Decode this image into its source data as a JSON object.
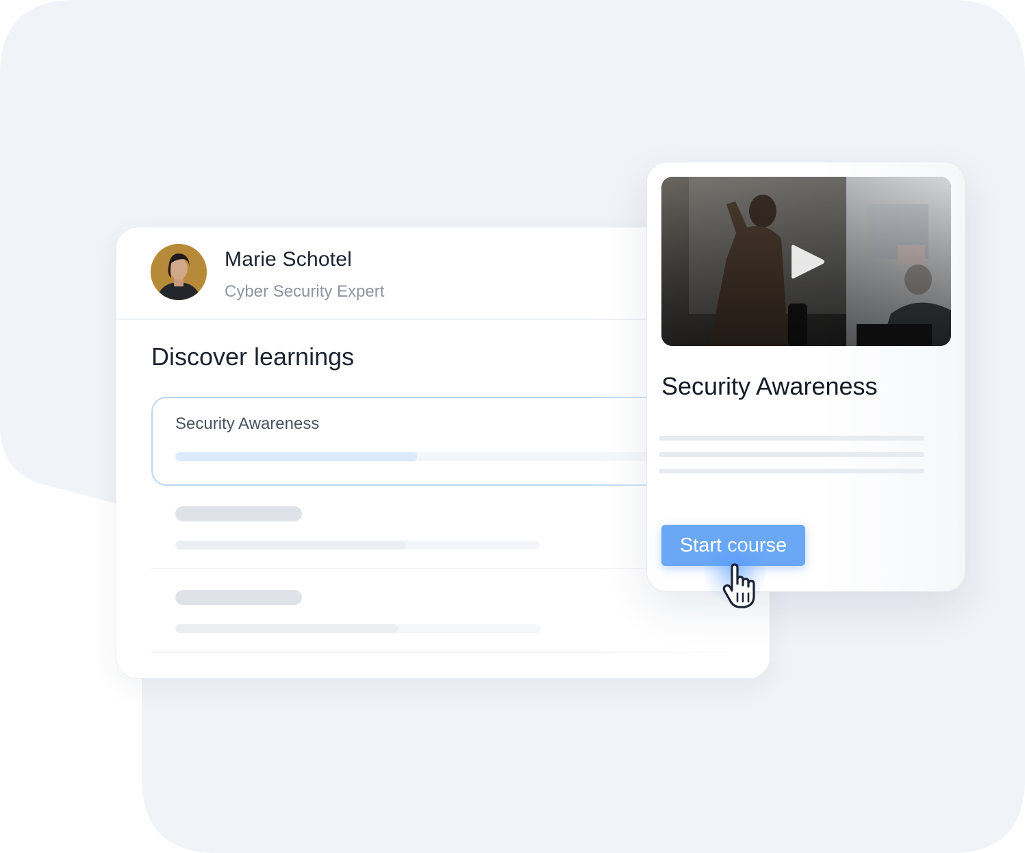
{
  "profile": {
    "name": "Marie Schotel",
    "role": "Cyber Security Expert",
    "avatar_icon": "profile-photo"
  },
  "learnings": {
    "title": "Discover learnings",
    "items": [
      {
        "label": "Security Awareness",
        "progress": 0.41,
        "active": true
      },
      {
        "label": "",
        "progress": 0.63,
        "placeholder": true
      },
      {
        "label": "",
        "progress": 0.61,
        "placeholder": true
      }
    ]
  },
  "course_card": {
    "title": "Security Awareness",
    "video_icon": "play-icon",
    "start_label": "Start course"
  },
  "colors": {
    "background": "#f0f3f7",
    "accent": "#6aa7f5",
    "progress_fill": "#dbeafc",
    "active_border": "#b9d7f7"
  },
  "cursor_icon": "pointer-hand-icon"
}
